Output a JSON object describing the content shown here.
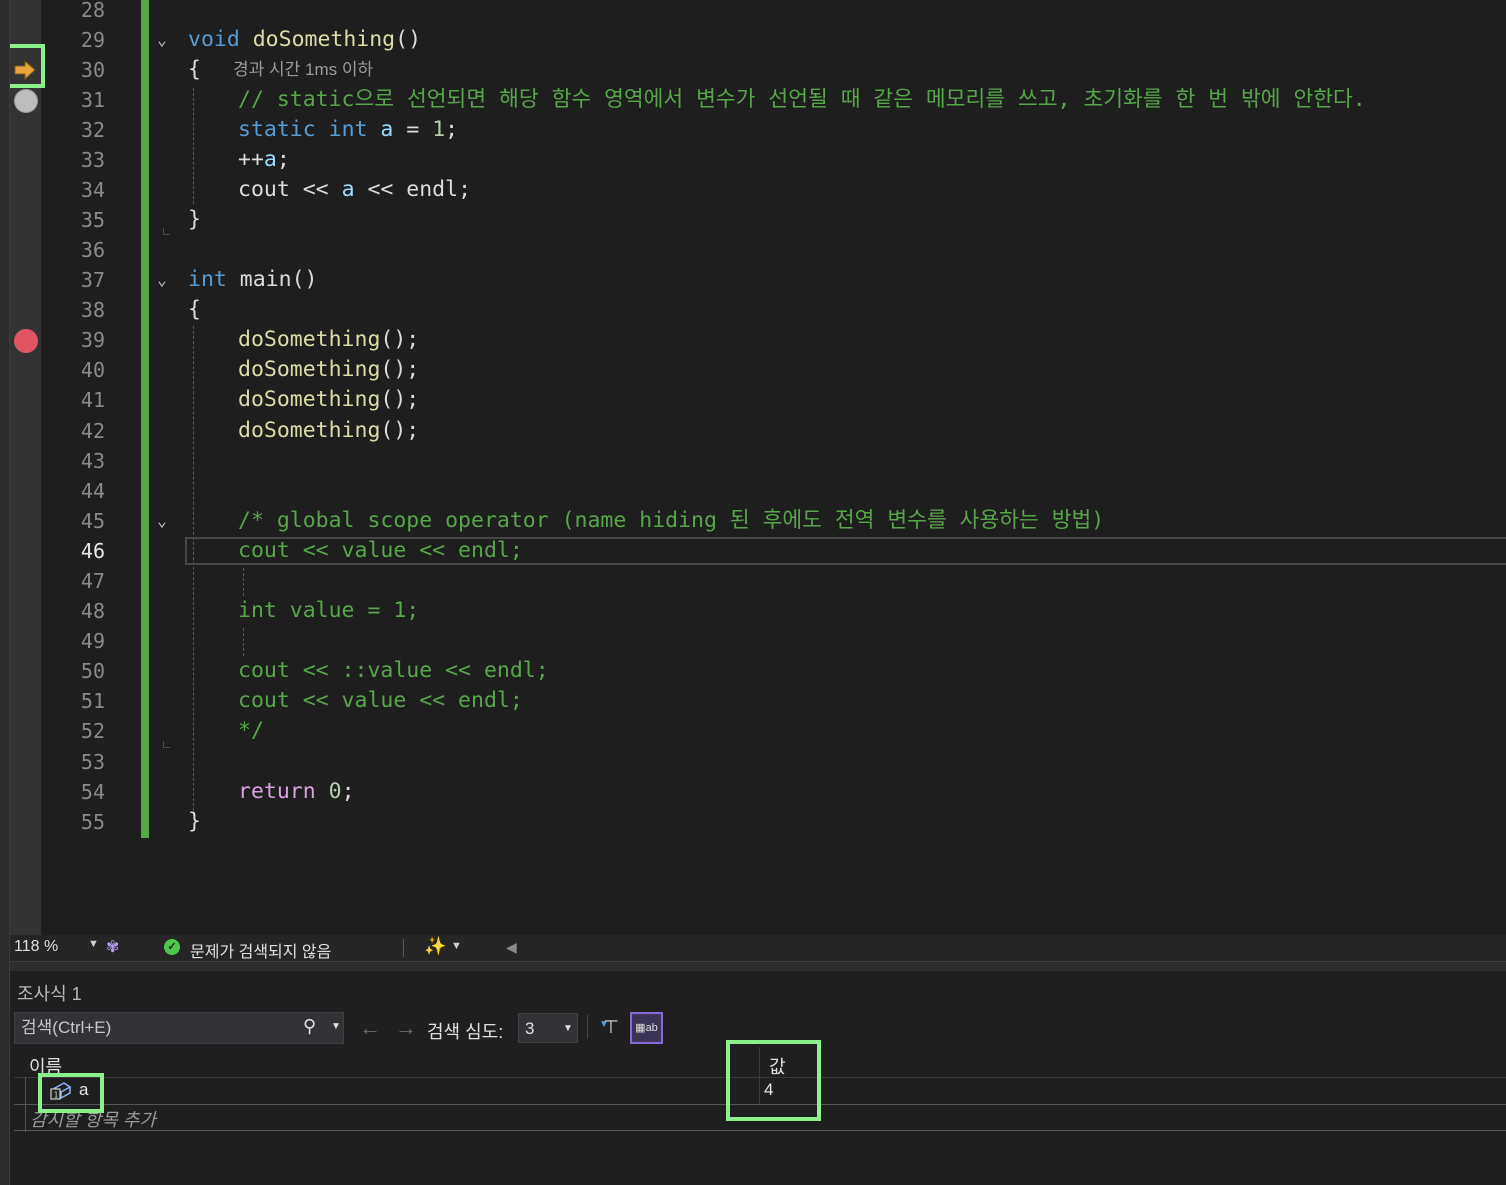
{
  "editor": {
    "line_numbers": [
      "28",
      "29",
      "30",
      "31",
      "32",
      "33",
      "34",
      "35",
      "36",
      "37",
      "38",
      "39",
      "40",
      "41",
      "42",
      "43",
      "44",
      "45",
      "46",
      "47",
      "48",
      "49",
      "50",
      "51",
      "52",
      "53",
      "54",
      "55"
    ],
    "current_line": "46",
    "perf_tip": "경과 시간 1ms 이하",
    "code": {
      "l29_kw": "void",
      "l29_fn": "doSomething",
      "l29_rest": "()",
      "l30": "{",
      "l31_cmt": "// static으로 선언되면 해당 함수 영역에서 변수가 선언될 때 같은 메모리를 쓰고, 초기화를 한 번 밖에 안한다.",
      "l32_kw1": "static",
      "l32_kw2": "int",
      "l32_var": "a",
      "l32_eq": " = ",
      "l32_num": "1",
      "l32_end": ";",
      "l33_op": "++",
      "l33_var": "a",
      "l33_end": ";",
      "l34_a": "cout << ",
      "l34_var": "a",
      "l34_b": " << endl;",
      "l35": "}",
      "l37_kw": "int",
      "l37_rest": " main()",
      "l38": "{",
      "l39_fn": "doSomething",
      "l39_rest": "();",
      "l40_fn": "doSomething",
      "l40_rest": "();",
      "l41_fn": "doSomething",
      "l41_rest": "();",
      "l42_fn": "doSomething",
      "l42_rest": "();",
      "l45_cmt": "/* global scope operator (name hiding 된 후에도 전역 변수를 사용하는 방법)",
      "l46_cmt": "cout << value << endl;",
      "l48_cmt": "int value = 1;",
      "l50_cmt": "cout << ::value << endl;",
      "l51_cmt": "cout << value << endl;",
      "l52_cmt": "*/",
      "l54_kw": "return",
      "l54_num": "0",
      "l54_end": ";",
      "l55": "}"
    }
  },
  "status_bar": {
    "zoom": "118 %",
    "issues_text": "문제가 검색되지 않음"
  },
  "watch_panel": {
    "title": "조사식 1",
    "search_placeholder": "검색(Ctrl+E)",
    "depth_label": "검색 심도:",
    "depth_value": "3",
    "col_name": "이름",
    "col_value": "값",
    "rows": [
      {
        "name": "a",
        "value": "4"
      }
    ],
    "add_item_placeholder": "감시할 항목 추가"
  },
  "colors": {
    "keyword": "#569cd6",
    "control_keyword": "#d8a0df",
    "function": "#dcdcaa",
    "variable": "#9cdcfe",
    "number": "#b5cea8",
    "comment": "#57a64a",
    "highlight_box": "#8cf08c",
    "breakpoint": "#e05561",
    "exec_arrow": "#e8a33a"
  }
}
